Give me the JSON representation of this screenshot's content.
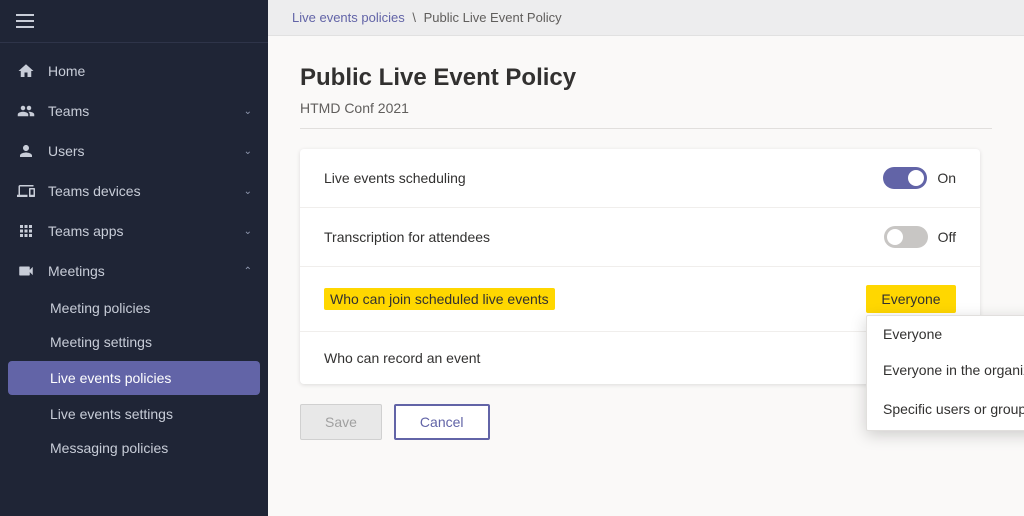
{
  "sidebar": {
    "nav_items": [
      {
        "id": "home",
        "label": "Home",
        "icon": "home",
        "hasChevron": false,
        "active": false
      },
      {
        "id": "teams",
        "label": "Teams",
        "icon": "teams",
        "hasChevron": true,
        "active": false
      },
      {
        "id": "users",
        "label": "Users",
        "icon": "users",
        "hasChevron": true,
        "active": false
      },
      {
        "id": "teams-devices",
        "label": "Teams devices",
        "icon": "devices",
        "hasChevron": true,
        "active": false
      },
      {
        "id": "teams-apps",
        "label": "Teams apps",
        "icon": "apps",
        "hasChevron": true,
        "active": false
      },
      {
        "id": "meetings",
        "label": "Meetings",
        "icon": "meetings",
        "hasChevron": true,
        "expanded": true,
        "active": false
      }
    ],
    "sub_items": [
      {
        "id": "meeting-policies",
        "label": "Meeting policies",
        "active": false
      },
      {
        "id": "meeting-settings",
        "label": "Meeting settings",
        "active": false
      },
      {
        "id": "live-events-policies",
        "label": "Live events policies",
        "active": true
      },
      {
        "id": "live-events-settings",
        "label": "Live events settings",
        "active": false
      },
      {
        "id": "messaging-policies",
        "label": "Messaging policies",
        "active": false
      }
    ]
  },
  "breadcrumb": {
    "parent_label": "Live events policies",
    "separator": "\\",
    "current_label": "Public Live Event Policy"
  },
  "page": {
    "title": "Public Live Event Policy",
    "policy_name": "HTMD Conf 2021"
  },
  "settings": {
    "rows": [
      {
        "id": "live-events-scheduling",
        "label": "Live events scheduling",
        "highlighted": false,
        "control_type": "toggle",
        "toggle_on": true,
        "value_label": "On"
      },
      {
        "id": "transcription-attendees",
        "label": "Transcription for attendees",
        "highlighted": false,
        "control_type": "toggle",
        "toggle_on": false,
        "value_label": "Off"
      },
      {
        "id": "who-can-join",
        "label": "Who can join scheduled live events",
        "highlighted": true,
        "control_type": "dropdown",
        "value_label": "Everyone"
      },
      {
        "id": "who-can-record",
        "label": "Who can record an event",
        "highlighted": false,
        "control_type": "none",
        "value_label": ""
      }
    ],
    "dropdown_options": [
      {
        "id": "everyone",
        "label": "Everyone",
        "has_accent": false
      },
      {
        "id": "everyone-org",
        "label": "Everyone in the organization",
        "has_accent": false
      },
      {
        "id": "specific-users",
        "label": "Specific users or groups",
        "has_accent": true
      }
    ]
  },
  "actions": {
    "save_label": "Save",
    "cancel_label": "Cancel"
  }
}
